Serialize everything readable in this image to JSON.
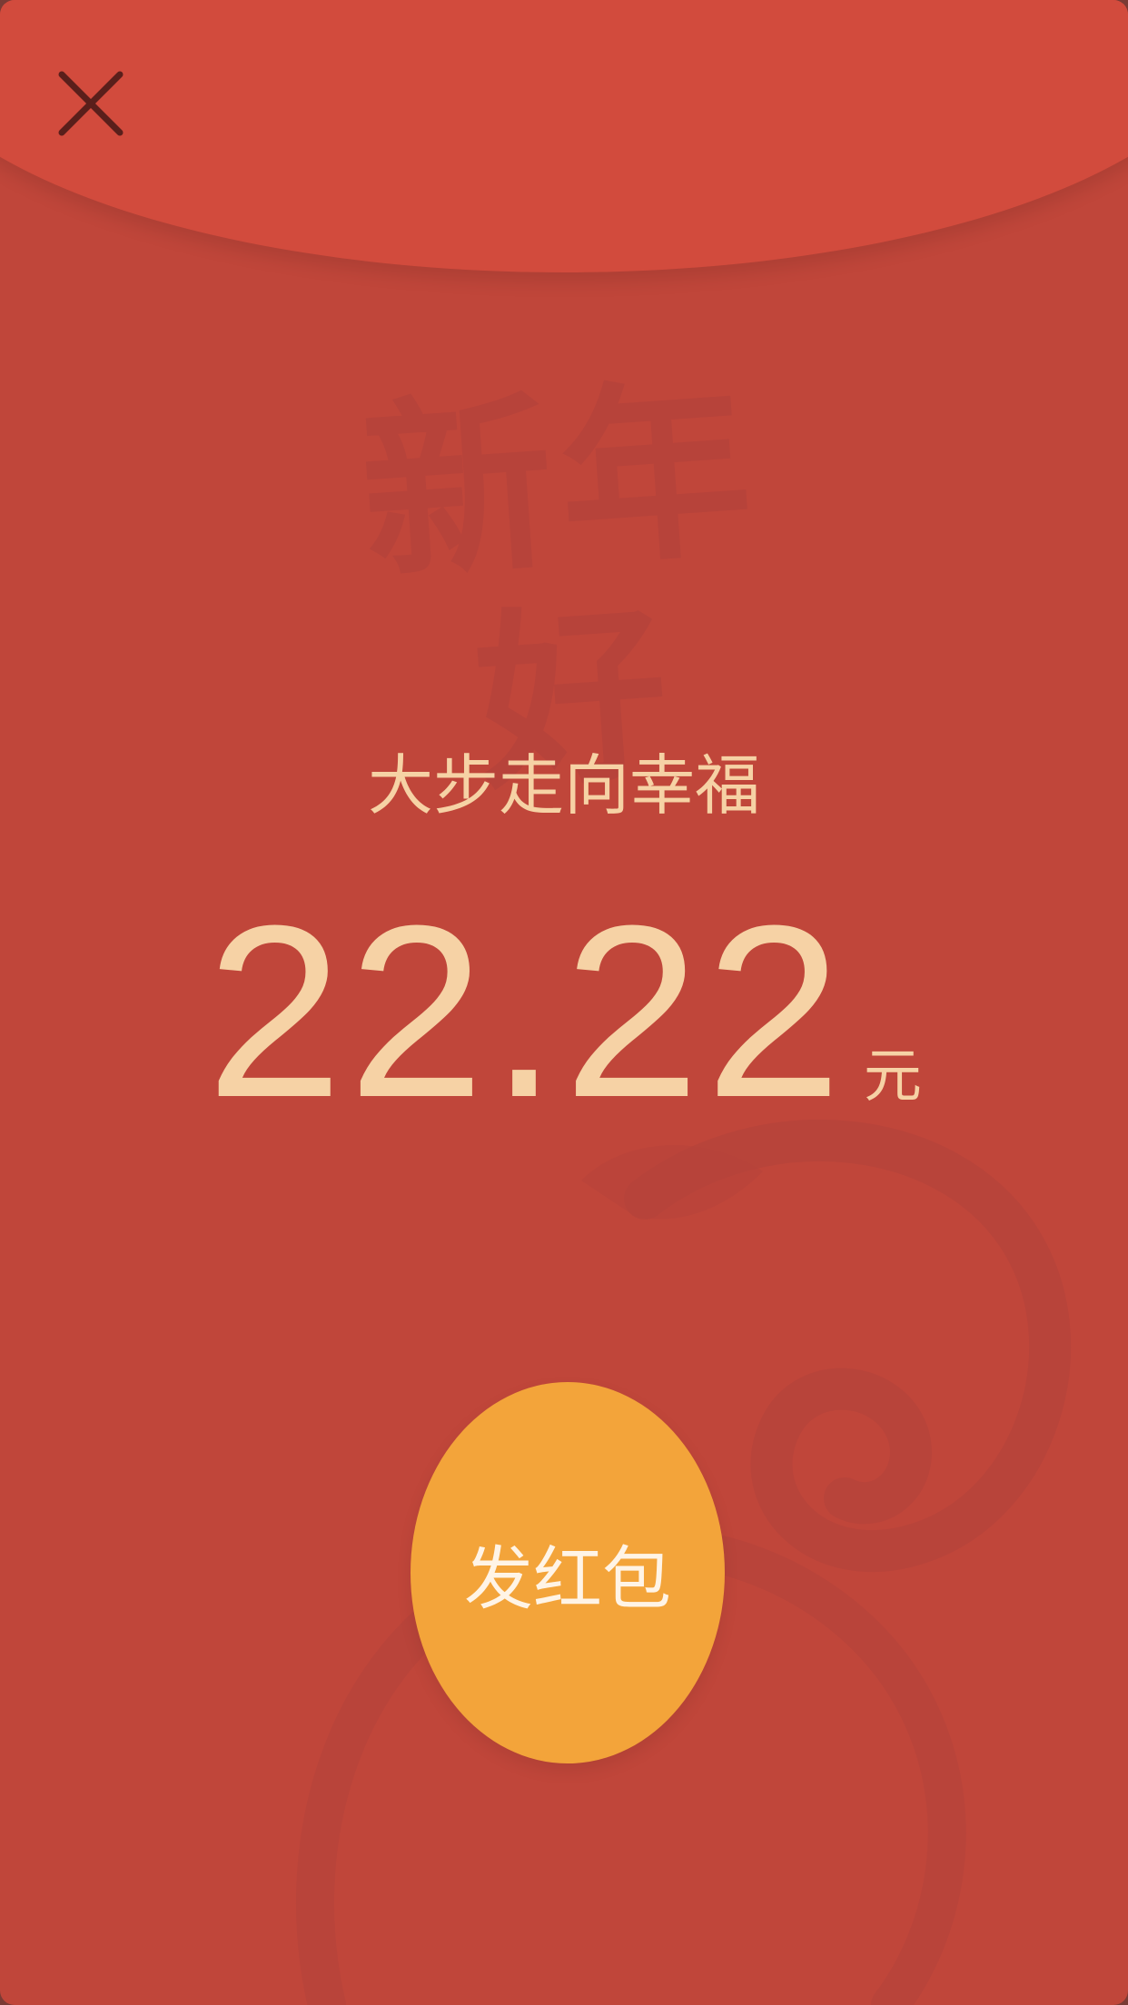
{
  "envelope": {
    "greeting": "新年好",
    "message": "大步走向幸福",
    "amount": "22.22",
    "unit": "元",
    "send_label": "发红包",
    "icons": {
      "close": "close-icon",
      "decoration": "monkey-decoration"
    },
    "colors": {
      "envelope": "#c0463a",
      "flap": "#d24b3d",
      "text": "#f6d2a5",
      "button": "#f3a43a"
    }
  }
}
